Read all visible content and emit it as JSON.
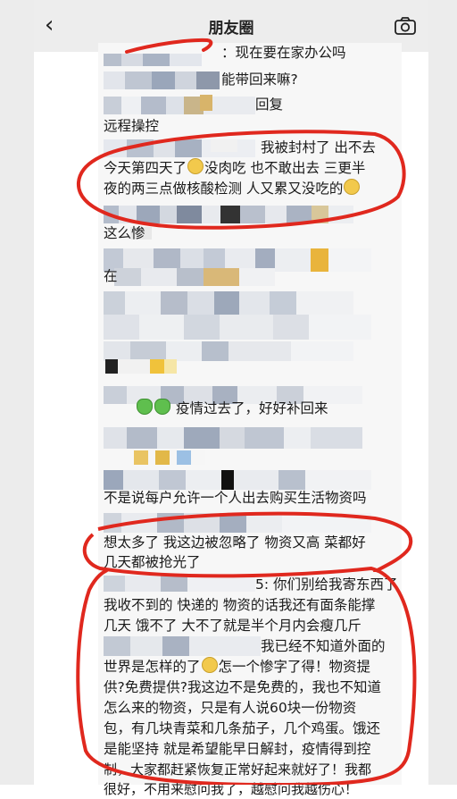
{
  "header": {
    "title": "朋友圈",
    "back_icon": "chevron-left-icon",
    "camera_icon": "camera-icon"
  },
  "comments": [
    {
      "text": "：现在要在家办公吗"
    },
    {
      "text": "能带回来嘛?"
    },
    {
      "text": "回复"
    },
    {
      "text": "远程操控"
    },
    {
      "text": "我被封村了 出不去"
    },
    {
      "text": "今天第四天了",
      "text2": "没肉吃  也不敢出去  三更半"
    },
    {
      "text": "夜的两三点做核酸检测  人又累又没吃的"
    },
    {
      "text": "这么惨"
    },
    {
      "text": "在"
    },
    {
      "text": "疫情过去了，好好补回来"
    },
    {
      "text": "不是说每户允许一个人出去购买生活物资吗"
    },
    {
      "text": "想太多了  我这边被忽略了  物资又高 菜都好"
    },
    {
      "text": "几天都被抢光了"
    },
    {
      "text": "5: 你们别给我寄东西了"
    },
    {
      "text": "我收不到的 快递的  物资的话我还有面条能撑"
    },
    {
      "text": "几天   饿不了  大不了就是半个月内会瘦几斤"
    },
    {
      "text": "我已经不知道外面的"
    },
    {
      "text": "世界是怎样的了",
      "text2": "怎一个惨字了得！物资提"
    },
    {
      "text": "供?免费提供?我这边不是免费的，我也不知道"
    },
    {
      "text": "怎么来的物资，只是有人说60块一份物资"
    },
    {
      "text": "包，有几块青菜和几条茄子，几个鸡蛋。饿还"
    },
    {
      "text": "是能坚持   就是希望能早日解封，疫情得到控"
    },
    {
      "text": "制，大家都赶紧恢复正常好起来就好了！我都"
    },
    {
      "text": "很好，不用来慰问我了，越慰问我越伤心！"
    }
  ],
  "colors": {
    "annotation_red": "#e0281e",
    "header_bg": "#ededed",
    "feed_bg": "#f7f7f7"
  }
}
